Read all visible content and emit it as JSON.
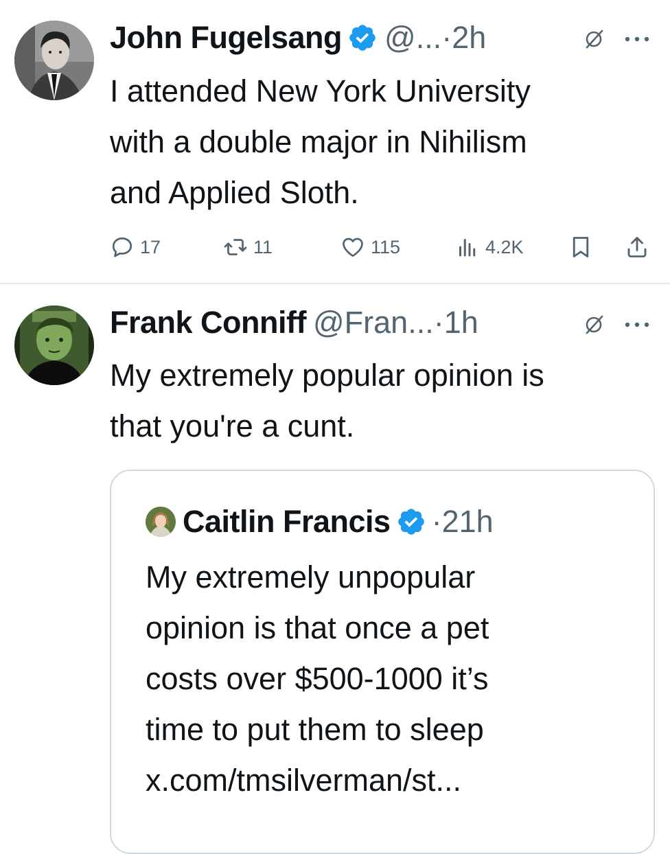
{
  "tweets": [
    {
      "author": "John Fugelsang",
      "handle": "@...",
      "dot": "·",
      "time": "2h",
      "verified": true,
      "text": "I attended New York University\nwith a double major in Nihilism\nand Applied Sloth.",
      "stats": {
        "replies": "17",
        "retweets": "11",
        "likes": "115",
        "views": "4.2K"
      }
    },
    {
      "author": "Frank Conniff",
      "handle": "@Fran...",
      "dot": "·",
      "time": "1h",
      "verified": false,
      "text": "My extremely popular opinion is\nthat you're a cunt.",
      "quote": {
        "author": "Caitlin Francis",
        "dot": "·",
        "time": "21h",
        "verified": true,
        "lines": [
          "My extremely unpopular",
          "opinion is that once a pet",
          "costs over $500-1000 it’s",
          "time to put them to sleep",
          "x.com/tmsilverman/st..."
        ]
      }
    }
  ],
  "colors": {
    "text": "#0f1419",
    "secondary": "#536471",
    "verified_blue": "#1d9bf0",
    "divider": "#e7e9ea",
    "quote_border": "#cfd9de"
  },
  "icons": {
    "reply": "reply-bubble-icon",
    "retweet": "retweet-arrows-icon",
    "like": "heart-icon",
    "views": "analytics-bars-icon",
    "bookmark": "bookmark-icon",
    "share": "share-upload-icon",
    "grok": "grok-slash-icon",
    "more": "more-dots-icon",
    "verified": "verified-badge-icon"
  }
}
